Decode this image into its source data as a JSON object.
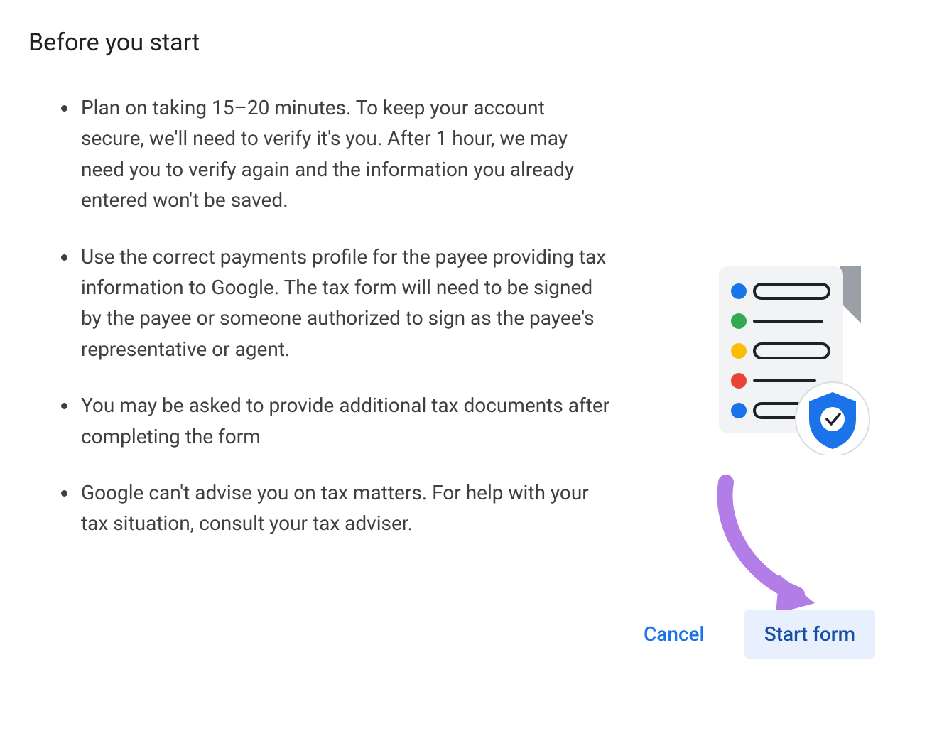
{
  "heading": "Before you start",
  "bullets": [
    "Plan on taking 15–20 minutes. To keep your account secure, we'll need to verify it's you. After 1 hour, we may need you to verify again and the information you already entered won't be saved.",
    "Use the correct payments profile for the payee providing tax information to Google. The tax form will need to be signed by the payee or someone authorized to sign as the payee's representative or agent.",
    "You may be asked to provide additional tax documents after completing the form",
    "Google can't advise you on tax matters. For help with your tax situation, consult your tax adviser."
  ],
  "actions": {
    "cancel": "Cancel",
    "start": "Start form"
  },
  "colors": {
    "primary_blue": "#1a73e8",
    "dark_blue": "#174ea6",
    "light_blue_bg": "#e8f0fe",
    "arrow": "#b37de8"
  }
}
